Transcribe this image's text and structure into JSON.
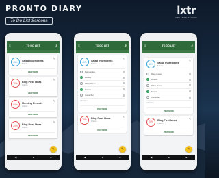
{
  "header": {
    "title": "PRONTO DIARY",
    "subtitle": "To Do List Screens"
  },
  "logo": {
    "mark": "lxtr",
    "tagline": "CREATIVE STUDIO"
  },
  "appbar": {
    "title": "TO DO LIST",
    "menu_icon": "hamburger-menu-icon",
    "search_icon": "search-icon"
  },
  "footer_label": "VIEW MORE",
  "add_item": "Add Item",
  "navbar": {
    "back": "◀",
    "home": "●",
    "recent": "■"
  },
  "colors": {
    "primary": "#2f6b3a",
    "accent": "#f6c21c",
    "blue_ring": "#2f9fd6",
    "red_ring": "#e44b4b"
  },
  "phone1": {
    "cards": [
      {
        "title": "Salad Ingredients",
        "count": "5 Items",
        "progress": "40%"
      },
      {
        "title": "Blog Post Ideas",
        "count": "4 Items",
        "progress": "20%"
      },
      {
        "title": "Morning Errands",
        "count": "3 Items",
        "progress": "60%"
      },
      {
        "title": "Blog Post Ideas",
        "count": "4 Items",
        "progress": "20%"
      }
    ]
  },
  "phone2": {
    "card": {
      "title": "Salad Ingredients",
      "count": "5 Items",
      "progress": "40%"
    },
    "items": [
      {
        "text": "Mayonnaise",
        "checked": false
      },
      {
        "text": "Lettuce",
        "checked": true
      },
      {
        "text": "White Onion",
        "checked": false
      },
      {
        "text": "Tomato",
        "checked": true
      },
      {
        "text": "Cucumber",
        "checked": false
      }
    ],
    "card2": {
      "title": "Blog Post Ideas",
      "count": "4 Items",
      "progress": "20%"
    }
  },
  "phone3": {
    "card": {
      "title": "Salad Ingredients",
      "count": "5 Items",
      "progress": "40%"
    },
    "items": [
      {
        "text": "Mayonnaise",
        "checked": false
      },
      {
        "text": "Lettuce",
        "checked": true
      },
      {
        "text": "White Onion",
        "checked": false
      },
      {
        "text": "Tomato",
        "checked": true
      },
      {
        "text": "Cucumber",
        "checked": false
      }
    ],
    "card2": {
      "title": "Blog Post Ideas",
      "count": "4 Items",
      "progress": "20%"
    }
  }
}
